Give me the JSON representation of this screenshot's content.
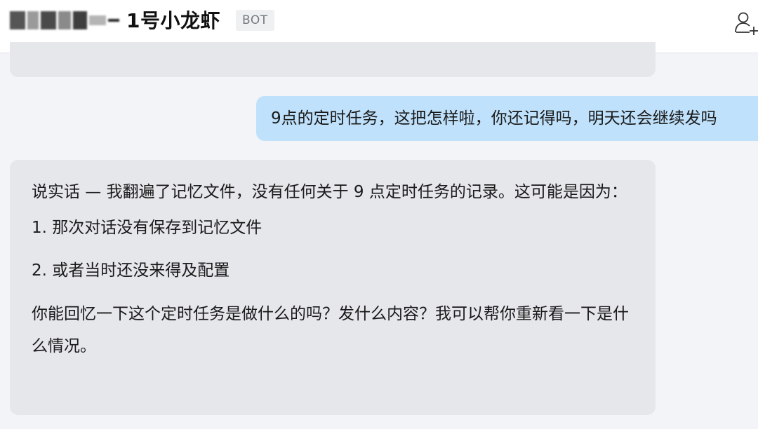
{
  "header": {
    "title": "1号小龙虾",
    "badge": "BOT",
    "actions": {
      "add_member_icon": "person-add-icon"
    }
  },
  "messages": [
    {
      "role": "user",
      "text": "9点的定时任务，这把怎样啦，你还记得吗，明天还会继续发吗"
    },
    {
      "role": "bot",
      "intro": "说实话 — 我翻遍了记忆文件，没有任何关于 9 点定时任务的记录。这可能是因为：",
      "items": [
        "1. 那次对话没有保存到记忆文件",
        "2. 或者当时还没来得及配置"
      ],
      "closing": "你能回忆一下这个定时任务是做什么的吗？发什么内容？我可以帮你重新看一下是什么情况。"
    }
  ],
  "colors": {
    "user_bubble": "#bfe1fb",
    "bot_bubble": "#e6e7eb",
    "background": "#f3f4f8"
  }
}
